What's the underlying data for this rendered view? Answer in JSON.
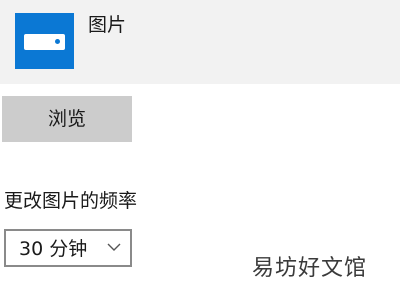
{
  "picture": {
    "label": "图片",
    "tile_color": "#0b78d4",
    "icon": "image-placeholder-icon"
  },
  "browse": {
    "label": "浏览"
  },
  "frequency": {
    "label": "更改图片的频率",
    "selected_value": "30 分钟",
    "icon": "chevron-down-icon"
  },
  "watermark": {
    "text": "易坊好文馆"
  }
}
